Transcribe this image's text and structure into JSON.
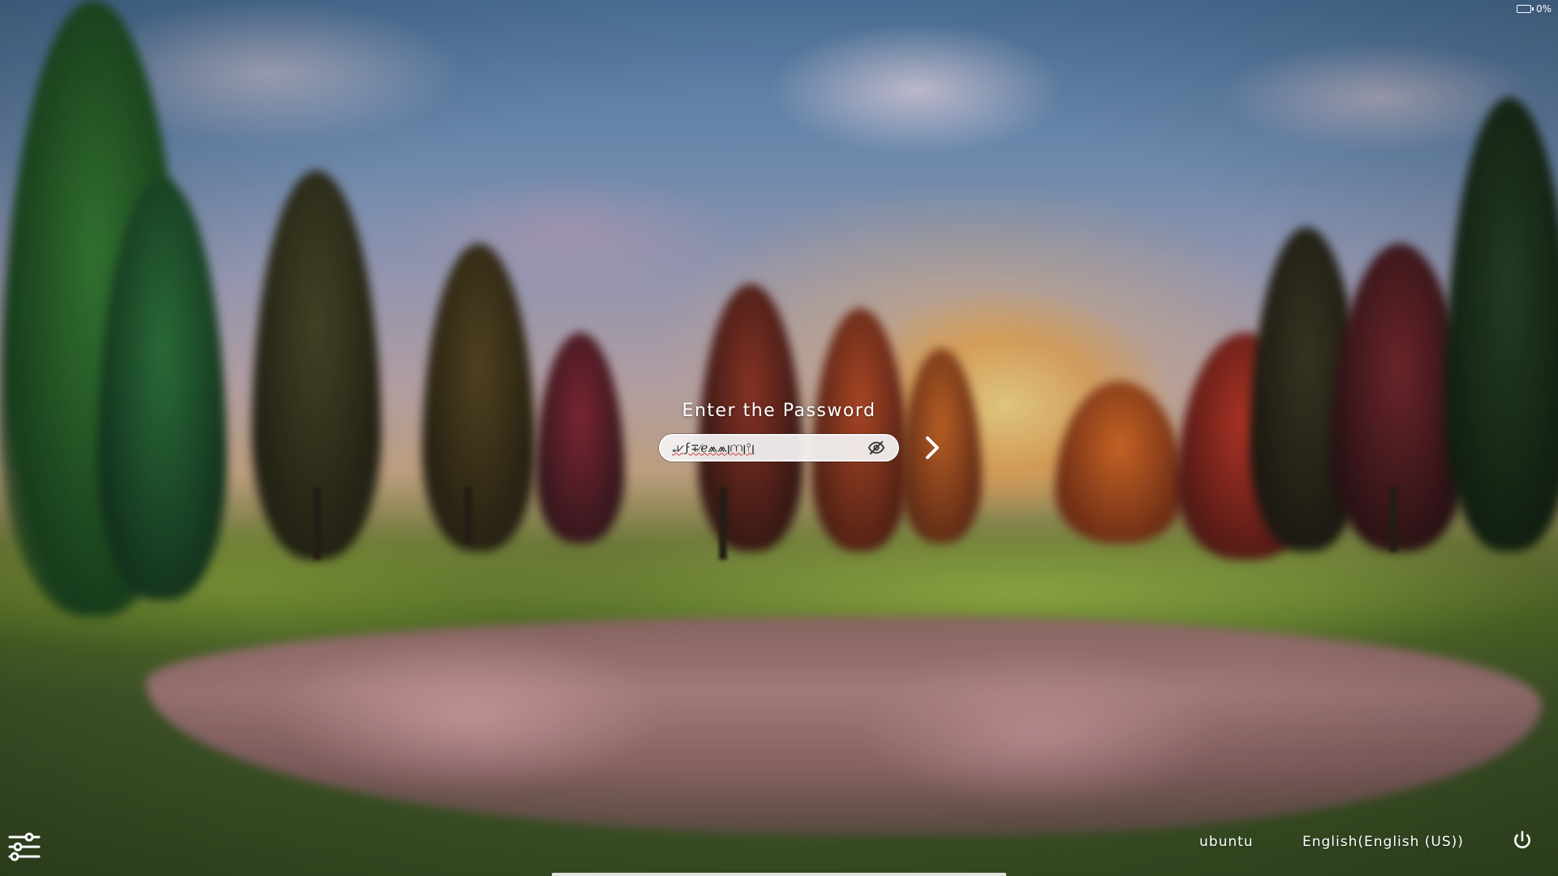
{
  "status": {
    "battery_icon": "battery-icon",
    "battery_percent": "0%"
  },
  "login": {
    "prompt": "Enter the Password",
    "password_value": "ಀ⩗ϝ∓⁄ℯ⩕⩕ꞁ⩋ꞁ⫯ꞁ",
    "show_password_icon": "eye-off-icon",
    "submit_icon": "chevron-right-icon"
  },
  "bottom": {
    "settings_icon": "sliders-icon",
    "username": "ubuntu",
    "language": "English(English (US))",
    "power_icon": "power-icon"
  },
  "colors": {
    "text": "#ffffff",
    "field_bg": "#f5f5f5",
    "spell_error": "#d33a3a"
  }
}
